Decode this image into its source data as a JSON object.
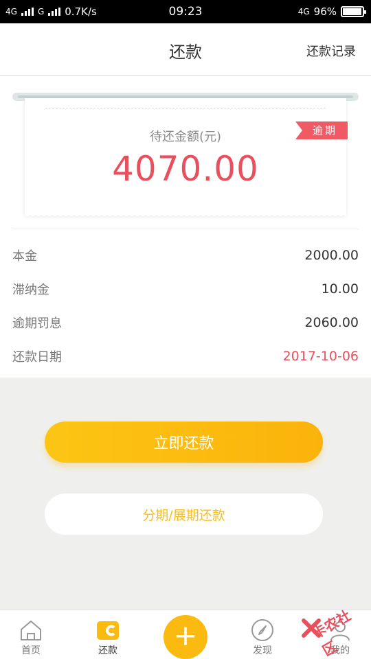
{
  "status_bar": {
    "signal_1": "4G",
    "signal_2": "G",
    "speed": "0.7K/s",
    "time": "09:23",
    "network": "4G",
    "battery": "96%",
    "battery_level": 0.96
  },
  "header": {
    "title": "还款",
    "record_link": "还款记录"
  },
  "bill": {
    "label": "待还金额(元)",
    "amount": "4070.00",
    "status_badge": "逾期"
  },
  "details": [
    {
      "key": "本金",
      "value": "2000.00"
    },
    {
      "key": "滞纳金",
      "value": "10.00"
    },
    {
      "key": "逾期罚息",
      "value": "2060.00"
    },
    {
      "key": "还款日期",
      "value": "2017-10-06"
    }
  ],
  "buttons": {
    "pay_now": "立即还款",
    "installment": "分期/展期还款"
  },
  "tabbar": {
    "home": "首页",
    "repay": "还款",
    "add": "+",
    "discover": "发现",
    "mine": "我的"
  },
  "colors": {
    "accent": "#fbba0f",
    "alert": "#e94f5c"
  },
  "watermark": {
    "text": "卡农社区"
  }
}
